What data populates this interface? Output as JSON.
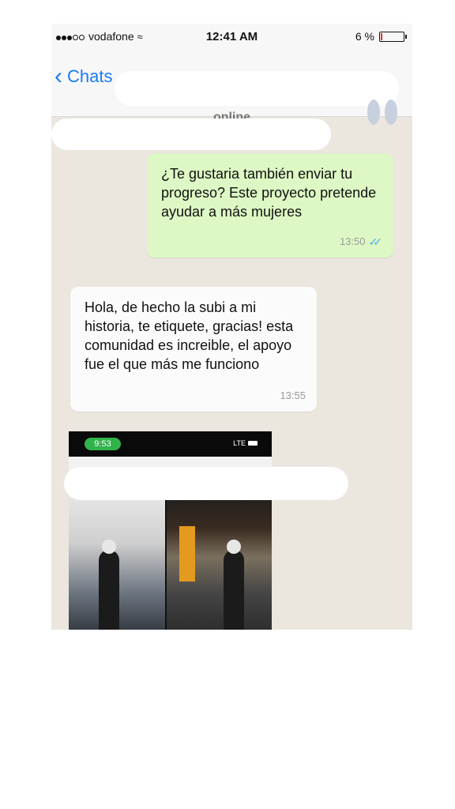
{
  "status_bar": {
    "carrier": "vodafone",
    "time": "12:41 AM",
    "battery_percent": "6 %",
    "battery_level": 0.06
  },
  "nav": {
    "back_label": "Chats",
    "contact_status": "online"
  },
  "messages": [
    {
      "direction": "outgoing",
      "text": "¿Te gustaria también enviar tu progreso? Este proyecto pretende ayudar a más mujeres",
      "time": "13:50",
      "read": true
    },
    {
      "direction": "incoming",
      "text": "Hola, de hecho la subi a mi historia, te etiquete, gracias! esta comunidad es increible, el apoyo fue el que más me funciono",
      "time": "13:55"
    }
  ],
  "image_message": {
    "screenshot_time": "9:53",
    "network": "LTE"
  },
  "colors": {
    "ios_blue": "#1a7cf5",
    "outgoing_bubble": "#ddf8c4",
    "incoming_bubble": "#fbfbfb",
    "chat_background": "#ebe6de",
    "read_ticks": "#4fb0ee"
  }
}
